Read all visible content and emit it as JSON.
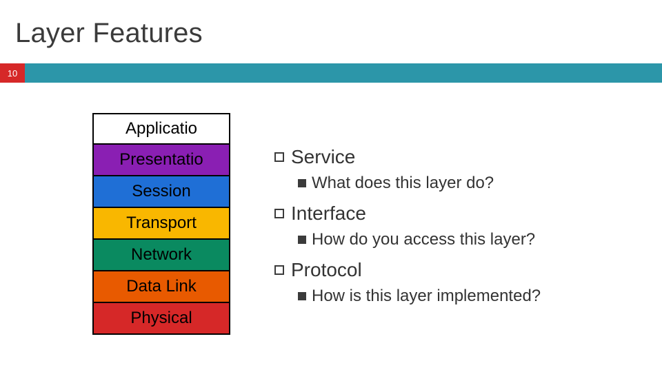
{
  "title": "Layer Features",
  "page_number": "10",
  "layers": [
    {
      "label": "Applicatio",
      "color": "white"
    },
    {
      "label": "Presentatio",
      "color": "purple"
    },
    {
      "label": "Session",
      "color": "blue"
    },
    {
      "label": "Transport",
      "color": "yellow"
    },
    {
      "label": "Network",
      "color": "teal"
    },
    {
      "label": "Data Link",
      "color": "orange"
    },
    {
      "label": "Physical",
      "color": "red"
    }
  ],
  "items": [
    {
      "label": "Service",
      "sub": "What does this layer do?"
    },
    {
      "label": "Interface",
      "sub": "How do you access this layer?"
    },
    {
      "label": "Protocol",
      "sub": "How is this layer implemented?"
    }
  ]
}
